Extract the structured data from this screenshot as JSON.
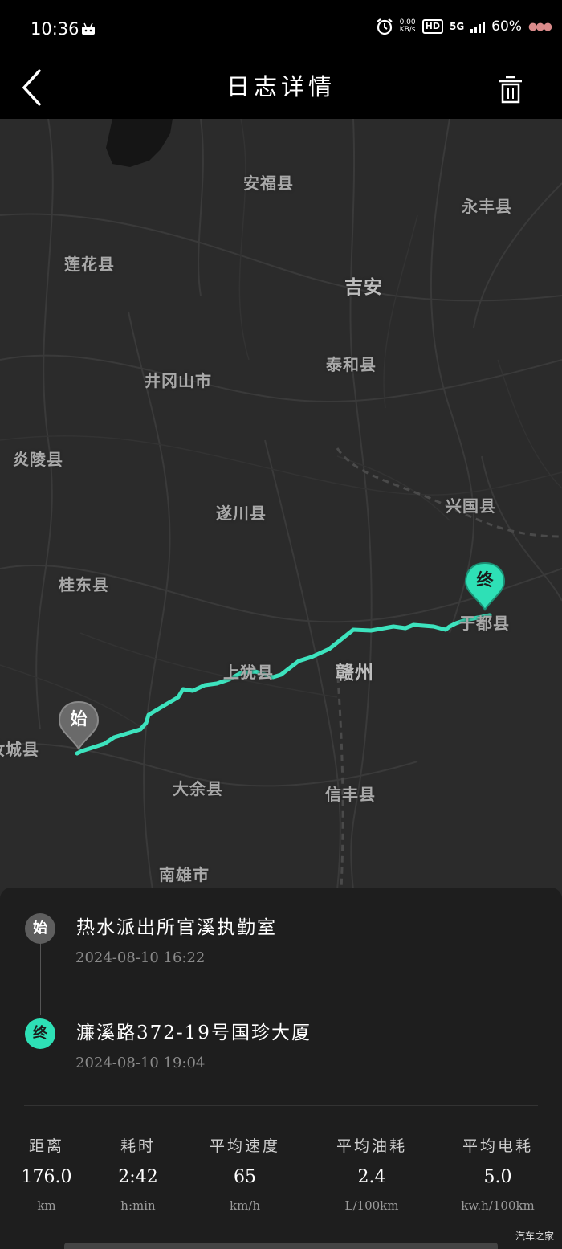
{
  "status_bar": {
    "time": "10:36",
    "net_speed_value": "0.00",
    "net_speed_unit": "KB/s",
    "hd": "HD",
    "network": "5G",
    "battery": "60%"
  },
  "header": {
    "title": "日志详情",
    "back_icon": "chevron-left-icon",
    "delete_icon": "trash-icon"
  },
  "map": {
    "route_color": "#3de3be",
    "labels": [
      {
        "name": "安福县",
        "big": false
      },
      {
        "name": "永丰县",
        "big": false
      },
      {
        "name": "莲花县",
        "big": false
      },
      {
        "name": "吉安",
        "big": true
      },
      {
        "name": "泰和县",
        "big": false
      },
      {
        "name": "井冈山市",
        "big": false
      },
      {
        "name": "炎陵县",
        "big": false
      },
      {
        "name": "遂川县",
        "big": false
      },
      {
        "name": "兴国县",
        "big": false
      },
      {
        "name": "桂东县",
        "big": false
      },
      {
        "name": "于都县",
        "big": false
      },
      {
        "name": "上犹县",
        "big": false
      },
      {
        "name": "赣州",
        "big": true
      },
      {
        "name": "汝城县",
        "big": false
      },
      {
        "name": "大余县",
        "big": false
      },
      {
        "name": "信丰县",
        "big": false
      },
      {
        "name": "南雄市",
        "big": false
      }
    ],
    "start_pin": "始",
    "end_pin": "终"
  },
  "trip": {
    "start": {
      "badge": "始",
      "place": "热水派出所官溪执勤室",
      "time": "2024-08-10 16:22"
    },
    "end": {
      "badge": "终",
      "place": "濂溪路372-19号国珍大厦",
      "time": "2024-08-10 19:04"
    }
  },
  "stats": [
    {
      "label": "距离",
      "value": "176.0",
      "unit": "km"
    },
    {
      "label": "耗时",
      "value": "2:42",
      "unit": "h:min"
    },
    {
      "label": "平均速度",
      "value": "65",
      "unit": "km/h"
    },
    {
      "label": "平均油耗",
      "value": "2.4",
      "unit": "L/100km"
    },
    {
      "label": "平均电耗",
      "value": "5.0",
      "unit": "kw.h/100km"
    }
  ],
  "watermark": "汽车之家"
}
